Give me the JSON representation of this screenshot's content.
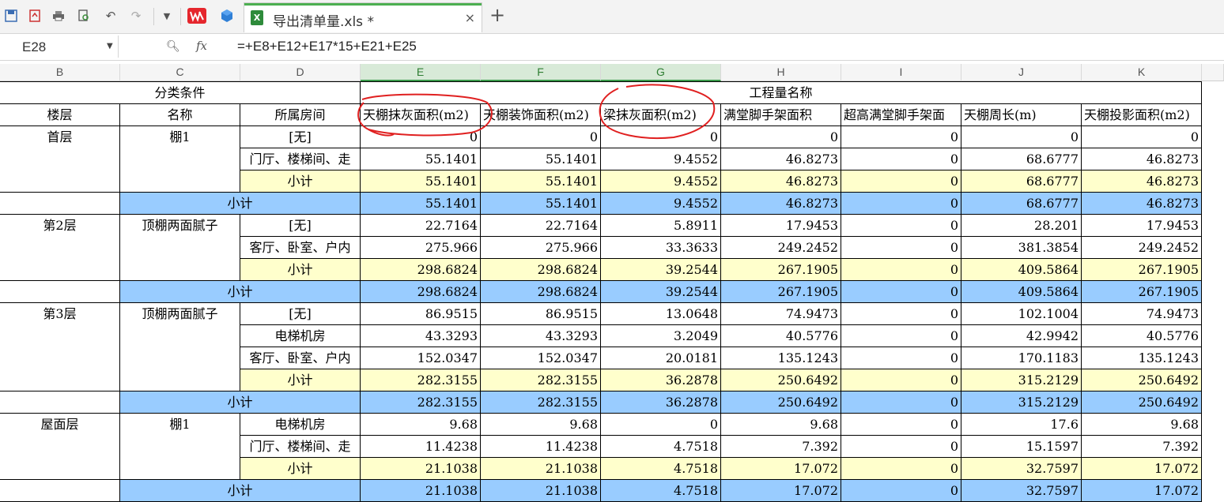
{
  "toolbar": {
    "icons": [
      "save-icon",
      "pdf-export-icon",
      "print-icon",
      "print-preview-icon",
      "undo-icon",
      "redo-icon",
      "more-arrow-icon",
      "wps-logo-icon",
      "cube-icon"
    ]
  },
  "tab": {
    "title": "导出清单量.xls *",
    "close": "×",
    "add": "+"
  },
  "formula_bar": {
    "cell_ref": "E28",
    "fx": "fx",
    "formula": "=+E8+E12+E17*15+E21+E25"
  },
  "columns": [
    "B",
    "C",
    "D",
    "E",
    "F",
    "G",
    "H",
    "I",
    "J",
    "K"
  ],
  "header1": {
    "left": "分类条件",
    "right": "工程量名称"
  },
  "header2": [
    "楼层",
    "名称",
    "所属房间",
    "天棚抹灰面积(m2)",
    "天棚装饰面积(m2)",
    "梁抹灰面积(m2)",
    "满堂脚手架面积",
    "超高满堂脚手架面",
    "天棚周长(m)",
    "天棚投影面积(m2)"
  ],
  "groups": [
    {
      "floor": "首层",
      "name": "棚1",
      "rows": [
        {
          "room": "[无]",
          "vals": [
            "0",
            "0",
            "0",
            "0",
            "0",
            "0",
            "0"
          ]
        },
        {
          "room": "门厅、楼梯间、走",
          "vals": [
            "55.1401",
            "55.1401",
            "9.4552",
            "46.8273",
            "0",
            "68.6777",
            "46.8273"
          ]
        },
        {
          "room": "小计",
          "vals": [
            "55.1401",
            "55.1401",
            "9.4552",
            "46.8273",
            "0",
            "68.6777",
            "46.8273"
          ],
          "type": "y"
        }
      ],
      "subtotal": {
        "label": "小计",
        "vals": [
          "55.1401",
          "55.1401",
          "9.4552",
          "46.8273",
          "0",
          "68.6777",
          "46.8273"
        ]
      }
    },
    {
      "floor": "第2层",
      "name": "顶棚两面腻子",
      "rows": [
        {
          "room": "[无]",
          "vals": [
            "22.7164",
            "22.7164",
            "5.8911",
            "17.9453",
            "0",
            "28.201",
            "17.9453"
          ]
        },
        {
          "room": "客厅、卧室、户内",
          "vals": [
            "275.966",
            "275.966",
            "33.3633",
            "249.2452",
            "0",
            "381.3854",
            "249.2452"
          ]
        },
        {
          "room": "小计",
          "vals": [
            "298.6824",
            "298.6824",
            "39.2544",
            "267.1905",
            "0",
            "409.5864",
            "267.1905"
          ],
          "type": "y"
        }
      ],
      "subtotal": {
        "label": "小计",
        "vals": [
          "298.6824",
          "298.6824",
          "39.2544",
          "267.1905",
          "0",
          "409.5864",
          "267.1905"
        ]
      }
    },
    {
      "floor": "第3层",
      "name": "顶棚两面腻子",
      "rows": [
        {
          "room": "[无]",
          "vals": [
            "86.9515",
            "86.9515",
            "13.0648",
            "74.9473",
            "0",
            "102.1004",
            "74.9473"
          ]
        },
        {
          "room": "电梯机房",
          "vals": [
            "43.3293",
            "43.3293",
            "3.2049",
            "40.5776",
            "0",
            "42.9942",
            "40.5776"
          ]
        },
        {
          "room": "客厅、卧室、户内",
          "vals": [
            "152.0347",
            "152.0347",
            "20.0181",
            "135.1243",
            "0",
            "170.1183",
            "135.1243"
          ]
        },
        {
          "room": "小计",
          "vals": [
            "282.3155",
            "282.3155",
            "36.2878",
            "250.6492",
            "0",
            "315.2129",
            "250.6492"
          ],
          "type": "y"
        }
      ],
      "subtotal": {
        "label": "小计",
        "vals": [
          "282.3155",
          "282.3155",
          "36.2878",
          "250.6492",
          "0",
          "315.2129",
          "250.6492"
        ]
      }
    },
    {
      "floor": "屋面层",
      "name": "棚1",
      "rows": [
        {
          "room": "电梯机房",
          "vals": [
            "9.68",
            "9.68",
            "0",
            "9.68",
            "0",
            "17.6",
            "9.68"
          ]
        },
        {
          "room": "门厅、楼梯间、走",
          "vals": [
            "11.4238",
            "11.4238",
            "4.7518",
            "7.392",
            "0",
            "15.1597",
            "7.392"
          ]
        },
        {
          "room": "小计",
          "vals": [
            "21.1038",
            "21.1038",
            "4.7518",
            "17.072",
            "0",
            "32.7597",
            "17.072"
          ],
          "type": "y"
        }
      ],
      "subtotal": {
        "label": "小计",
        "vals": [
          "21.1038",
          "21.1038",
          "4.7518",
          "17.072",
          "0",
          "32.7597",
          "17.072"
        ]
      }
    }
  ],
  "colors": {
    "subtotal_yellow": "#ffffcc",
    "subtotal_blue": "#99ccff",
    "annotation_red": "#e02020",
    "selected_col": "#d8ead8"
  }
}
